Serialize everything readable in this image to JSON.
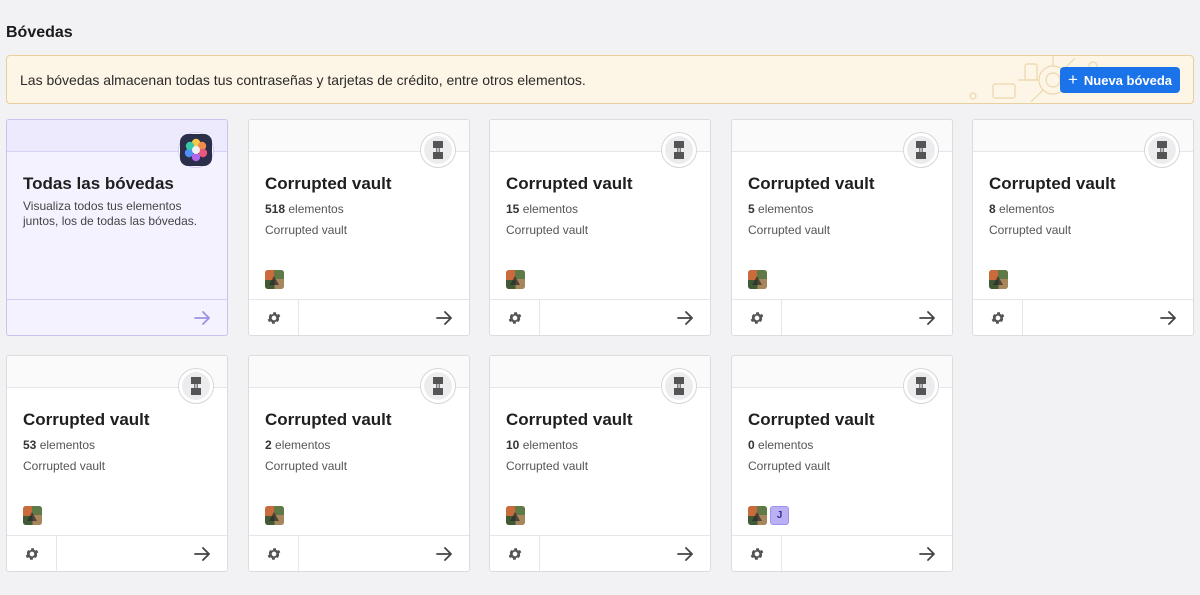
{
  "page": {
    "title": "Bóvedas"
  },
  "banner": {
    "text": "Las bóvedas almacenan todas tus contraseñas y tarjetas de crédito, entre otros elementos.",
    "button_label": "Nueva bóveda",
    "button_color": "#1a73e8"
  },
  "all_vaults": {
    "name": "Todas las bóvedas",
    "description": "Visualiza todos tus elementos juntos, los de todas las bóvedas.",
    "icon": "all-vaults-icon"
  },
  "vaults": [
    {
      "name": "Corrupted vault",
      "count": "518",
      "count_suffix": " elementos",
      "description": "Corrupted vault",
      "extra_avatar": ""
    },
    {
      "name": "Corrupted vault",
      "count": "15",
      "count_suffix": " elementos",
      "description": "Corrupted vault",
      "extra_avatar": ""
    },
    {
      "name": "Corrupted vault",
      "count": "5",
      "count_suffix": " elementos",
      "description": "Corrupted vault",
      "extra_avatar": ""
    },
    {
      "name": "Corrupted vault",
      "count": "8",
      "count_suffix": " elementos",
      "description": "Corrupted vault",
      "extra_avatar": ""
    },
    {
      "name": "Corrupted vault",
      "count": "53",
      "count_suffix": " elementos",
      "description": "Corrupted vault",
      "extra_avatar": ""
    },
    {
      "name": "Corrupted vault",
      "count": "2",
      "count_suffix": " elementos",
      "description": "Corrupted vault",
      "extra_avatar": ""
    },
    {
      "name": "Corrupted vault",
      "count": "10",
      "count_suffix": " elementos",
      "description": "Corrupted vault",
      "extra_avatar": ""
    },
    {
      "name": "Corrupted vault",
      "count": "0",
      "count_suffix": " elementos",
      "description": "Corrupted vault",
      "extra_avatar": "J"
    }
  ],
  "icons": {
    "vault": "vault-lock-icon",
    "settings": "gear-icon",
    "open": "arrow-right-icon",
    "add": "plus-icon"
  }
}
